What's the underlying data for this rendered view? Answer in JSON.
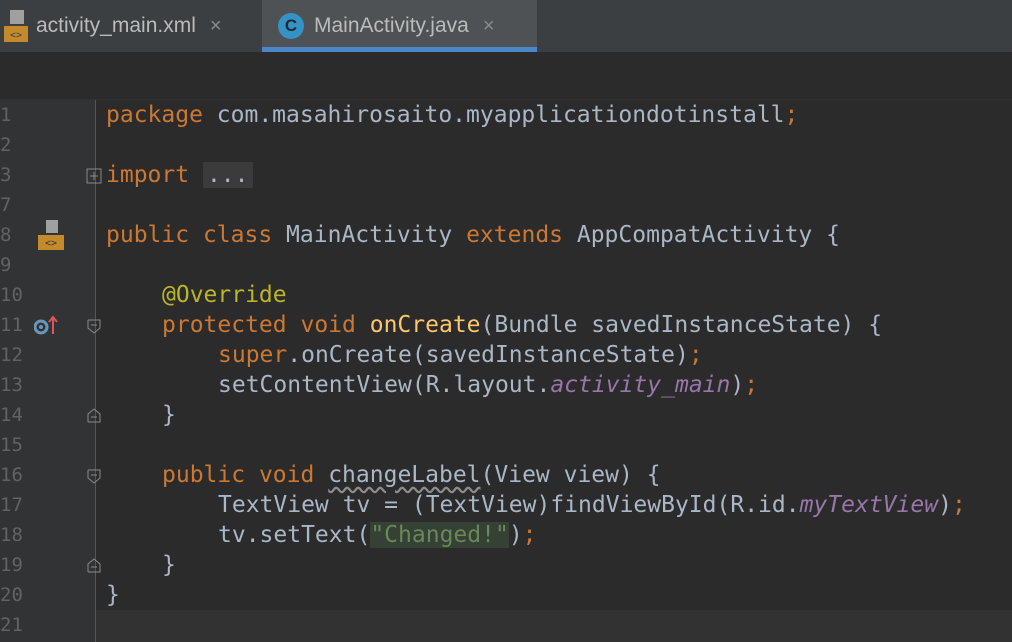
{
  "tabs": [
    {
      "label": "activity_main.xml",
      "close": "×",
      "icon": "xml-layout-icon"
    },
    {
      "label": "MainActivity.java",
      "close": "×",
      "icon": "java-class-icon",
      "icon_letter": "C",
      "active": true
    }
  ],
  "line_numbers": [
    "1",
    "2",
    "3",
    "7",
    "8",
    "9",
    "10",
    "11",
    "12",
    "13",
    "14",
    "15",
    "16",
    "17",
    "18",
    "19",
    "20",
    "21"
  ],
  "code": {
    "l1": {
      "kw": "package",
      "rest": " com.masahirosaito.myapplicationdotinstall",
      "semi": ";"
    },
    "l3": {
      "kw": "import",
      "dots": "..."
    },
    "l8": {
      "kw1": "public",
      "kw2": "class",
      "name": " MainActivity ",
      "kw3": "extends",
      "rest": " AppCompatActivity {"
    },
    "l10": {
      "ann": "@Override"
    },
    "l11": {
      "kw1": "protected",
      "kw2": "void",
      "fn": "onCreate",
      "rest": "(Bundle savedInstanceState) {"
    },
    "l12": {
      "kw": "super",
      "rest": ".onCreate(savedInstanceState)",
      "semi": ";"
    },
    "l13": {
      "pre": "setContentView(R.layout.",
      "fld": "activity_main",
      "post": ")",
      "semi": ";"
    },
    "l14": {
      "text": "}"
    },
    "l16": {
      "kw1": "public",
      "kw2": "void",
      "fn": "changeLabel",
      "rest": "(View view) {"
    },
    "l17": {
      "pre": "TextView tv = (TextView)findViewById(R.id.",
      "fld": "myTextView",
      "post": ")",
      "semi": ";"
    },
    "l18": {
      "pre": "tv.setText(",
      "str": "\"Changed!\"",
      "post": ")",
      "semi": ";"
    },
    "l19": {
      "text": "}"
    },
    "l20": {
      "text": "}"
    }
  },
  "colors": {
    "keyword": "#cc7832",
    "annotation": "#bbb529",
    "method": "#ffc66d",
    "field": "#9876aa",
    "string": "#6a8759",
    "accent": "#4a88c7"
  }
}
